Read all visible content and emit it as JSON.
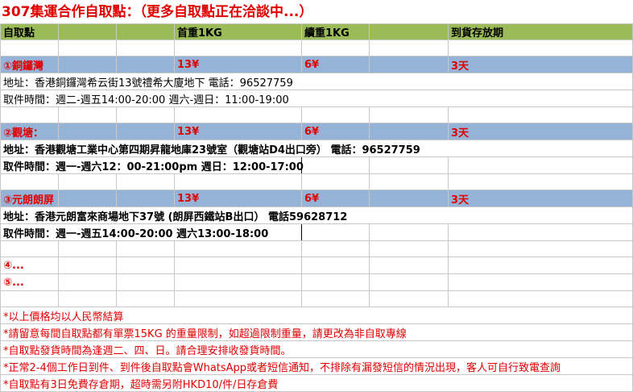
{
  "title": "307集運合作自取點：（更多自取點正在洽談中...）",
  "header": {
    "col1": "自取點",
    "col2": "首重1KG",
    "col3": "續重1KG",
    "col4": "到貨存放期"
  },
  "locations": [
    {
      "name": "①銅鑼灣",
      "first_kg": "13¥",
      "extra_kg": "6¥",
      "storage": "3天",
      "address": "地址：香港銅鑼灣希云街13號禮希大廈地下   電話：96527759",
      "hours": "取件時間：週二-週五14:00-20:00  週六-週日：11:00-19:00"
    },
    {
      "name": "②觀塘：",
      "first_kg": "13¥",
      "extra_kg": "6¥",
      "storage": "3天",
      "address": "地址：香港觀塘工業中心第四期昇龍地庫23號室（觀塘站D4出口旁）   電話：96527759",
      "hours": "取件時間：週一-週六12：00-21:00pm  週日：12:00-17:00"
    },
    {
      "name": "③元朗朗屏",
      "first_kg": "13¥",
      "extra_kg": "6¥",
      "storage": "3天",
      "address": "地址：香港元朗富來商場地下37號  (朗屏西鐵站B出口）    電話59628712",
      "hours": "取件時間：週一-週五14:00-20:00  週六13:00-18:00"
    }
  ],
  "more": [
    "④...",
    "⑤..."
  ],
  "notes": [
    "*以上價格均以人民幣結算",
    "*請留意每間自取點都有單票15KG 的重量限制，如超過限制重量，請更改為非自取專線",
    "*自取點發貨時間為逢週二、四、日。請合理安排收發貨時間。",
    "*正常2-4個工作日到件、到件後自取點會WhatsApp或者短信通知，不排除有漏發短信的情況出現，客人可自行致電查詢",
    "*自取點有3日免費存倉期，超時需另附HKD10/件/日存倉費"
  ],
  "colors": {
    "header_green": "#9bbb59",
    "location_blue": "#95b3d7",
    "text_red": "#e00000"
  }
}
